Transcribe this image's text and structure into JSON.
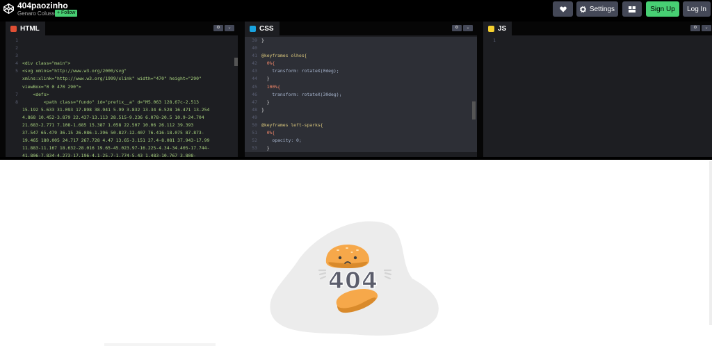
{
  "header": {
    "title": "404paozinho",
    "author": "Genaro Colusso",
    "follow": "+ Follow",
    "settings": "Settings",
    "signup": "Sign Up",
    "login": "Log In"
  },
  "tabs": {
    "html": "HTML",
    "css": "CSS",
    "js": "JS"
  },
  "colors": {
    "html_icon": "#e04f34",
    "css_icon": "#19a3e0",
    "js_icon": "#f6d02f",
    "accent": "#47cf73"
  },
  "html_code": [
    {
      "n": "1",
      "t": ""
    },
    {
      "n": "2",
      "t": ""
    },
    {
      "n": "3",
      "t": ""
    },
    {
      "n": "4",
      "t": "<div class=\"main\">"
    },
    {
      "n": "5",
      "t": "<svg xmlns=\"http://www.w3.org/2000/svg\""
    },
    {
      "n": "",
      "t": "xmlns:xlink=\"http://www.w3.org/1999/xlink\" width=\"470\" height=\"290\""
    },
    {
      "n": "",
      "t": "viewBox=\"0 0 470 290\">"
    },
    {
      "n": "7",
      "t": "    <defs>"
    },
    {
      "n": "8",
      "t": "        <path class=\"fundo\" id=\"prefix__a\" d=\"M5.063 128.67c-2.513"
    },
    {
      "n": "",
      "t": "15.192 5.633 31.093 17.898 38.941 5.99 3.832 13.34 6.528 16.471 13.254"
    },
    {
      "n": "",
      "t": "4.868 10.452-3.879 22.437-13.113 28.515-9.236 6.078-20.5 10.9-24.704"
    },
    {
      "n": "",
      "t": "21.683-2.771 7.108-1.685 15.387 1.058 22.507 10.06 26.112 39.393"
    },
    {
      "n": "",
      "t": "37.547 65.479 36.15 26.086-1.396 50.827-12.407 76.416-18.075 87.873-"
    },
    {
      "n": "",
      "t": "19.465 180.005 24.717 267.728 4.47 13.65-3.151 27.4-8.081 37.943-17.99"
    },
    {
      "n": "",
      "t": "11.883-11.167 18.632-28.016 19.65-45.023.97-16.225-4.34-34.405-17.744-"
    },
    {
      "n": "",
      "t": "41.806-7.834-4.273-17.196-4.1-25.7-1.774-5.43 1.483-10.767 3.808-"
    }
  ],
  "css_code": [
    {
      "n": "39",
      "t": "}"
    },
    {
      "n": "40",
      "t": ""
    },
    {
      "n": "41",
      "t": "@keyframes olhos{"
    },
    {
      "n": "42",
      "t": "  0%{"
    },
    {
      "n": "43",
      "t": "    transform: rotateX(0deg);"
    },
    {
      "n": "44",
      "t": "  }"
    },
    {
      "n": "45",
      "t": "  100%{"
    },
    {
      "n": "46",
      "t": "    transform: rotateX(30deg);"
    },
    {
      "n": "47",
      "t": "  }"
    },
    {
      "n": "48",
      "t": "}"
    },
    {
      "n": "49",
      "t": ""
    },
    {
      "n": "50",
      "t": "@keyframes left-sparks{"
    },
    {
      "n": "51",
      "t": "  0%{"
    },
    {
      "n": "52",
      "t": "    opacity: 0;"
    },
    {
      "n": "53",
      "t": "  }"
    }
  ],
  "js_code": [
    {
      "n": "1",
      "t": ""
    }
  ],
  "preview": {
    "text_404": "404"
  }
}
